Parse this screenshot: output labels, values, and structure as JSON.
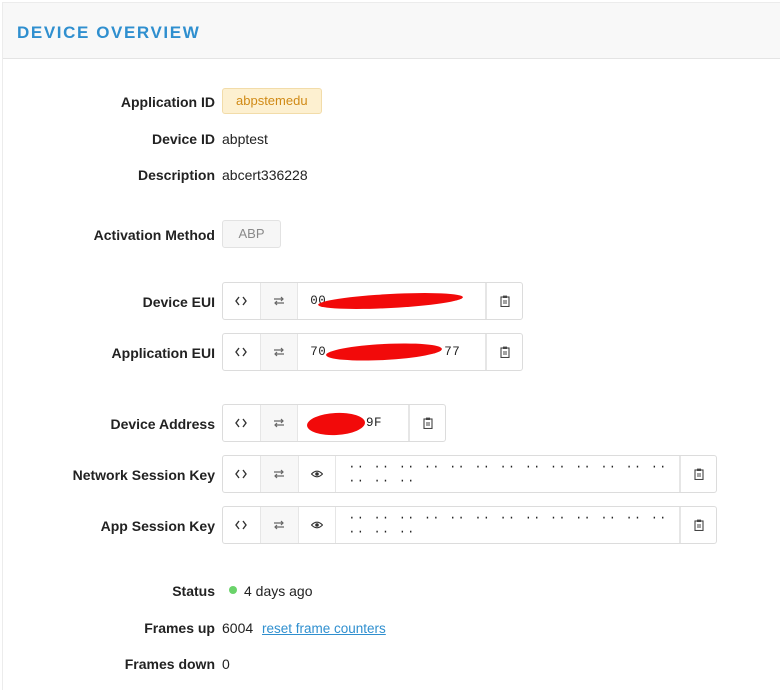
{
  "header": {
    "title": "DEVICE OVERVIEW"
  },
  "fields": {
    "application_id": {
      "label": "Application ID",
      "value": "abpstemedu"
    },
    "device_id": {
      "label": "Device ID",
      "value": "abptest"
    },
    "description": {
      "label": "Description",
      "value": "abcert336228"
    },
    "activation_method": {
      "label": "Activation Method",
      "value": "ABP"
    },
    "device_eui": {
      "label": "Device EUI",
      "value": "00 "
    },
    "application_eui": {
      "label": "Application EUI",
      "value": "70",
      "value_end": "77"
    },
    "device_address": {
      "label": "Device Address",
      "value": "9F"
    },
    "network_session_key": {
      "label": "Network Session Key",
      "value": "·· ·· ·· ·· ·· ·· ·· ·· ·· ·· ·· ·· ·· ·· ·· ··"
    },
    "app_session_key": {
      "label": "App Session Key",
      "value": "·· ·· ·· ·· ·· ·· ·· ·· ·· ·· ·· ·· ·· ·· ·· ··"
    },
    "status": {
      "label": "Status",
      "value": "4 days ago",
      "indicator_color": "#6ad36a"
    },
    "frames_up": {
      "label": "Frames up",
      "value": "6004",
      "link": "reset frame counters"
    },
    "frames_down": {
      "label": "Frames down",
      "value": "0"
    }
  },
  "icons": {
    "format": "code-brackets-icon",
    "byte_order": "swap-arrows-icon",
    "reveal": "eye-icon",
    "copy": "clipboard-icon"
  },
  "colors": {
    "accent": "#2f8fcf",
    "app_tag_bg": "#fdf0d0",
    "app_tag_text": "#d08a16",
    "redaction": "#f20a0a"
  }
}
